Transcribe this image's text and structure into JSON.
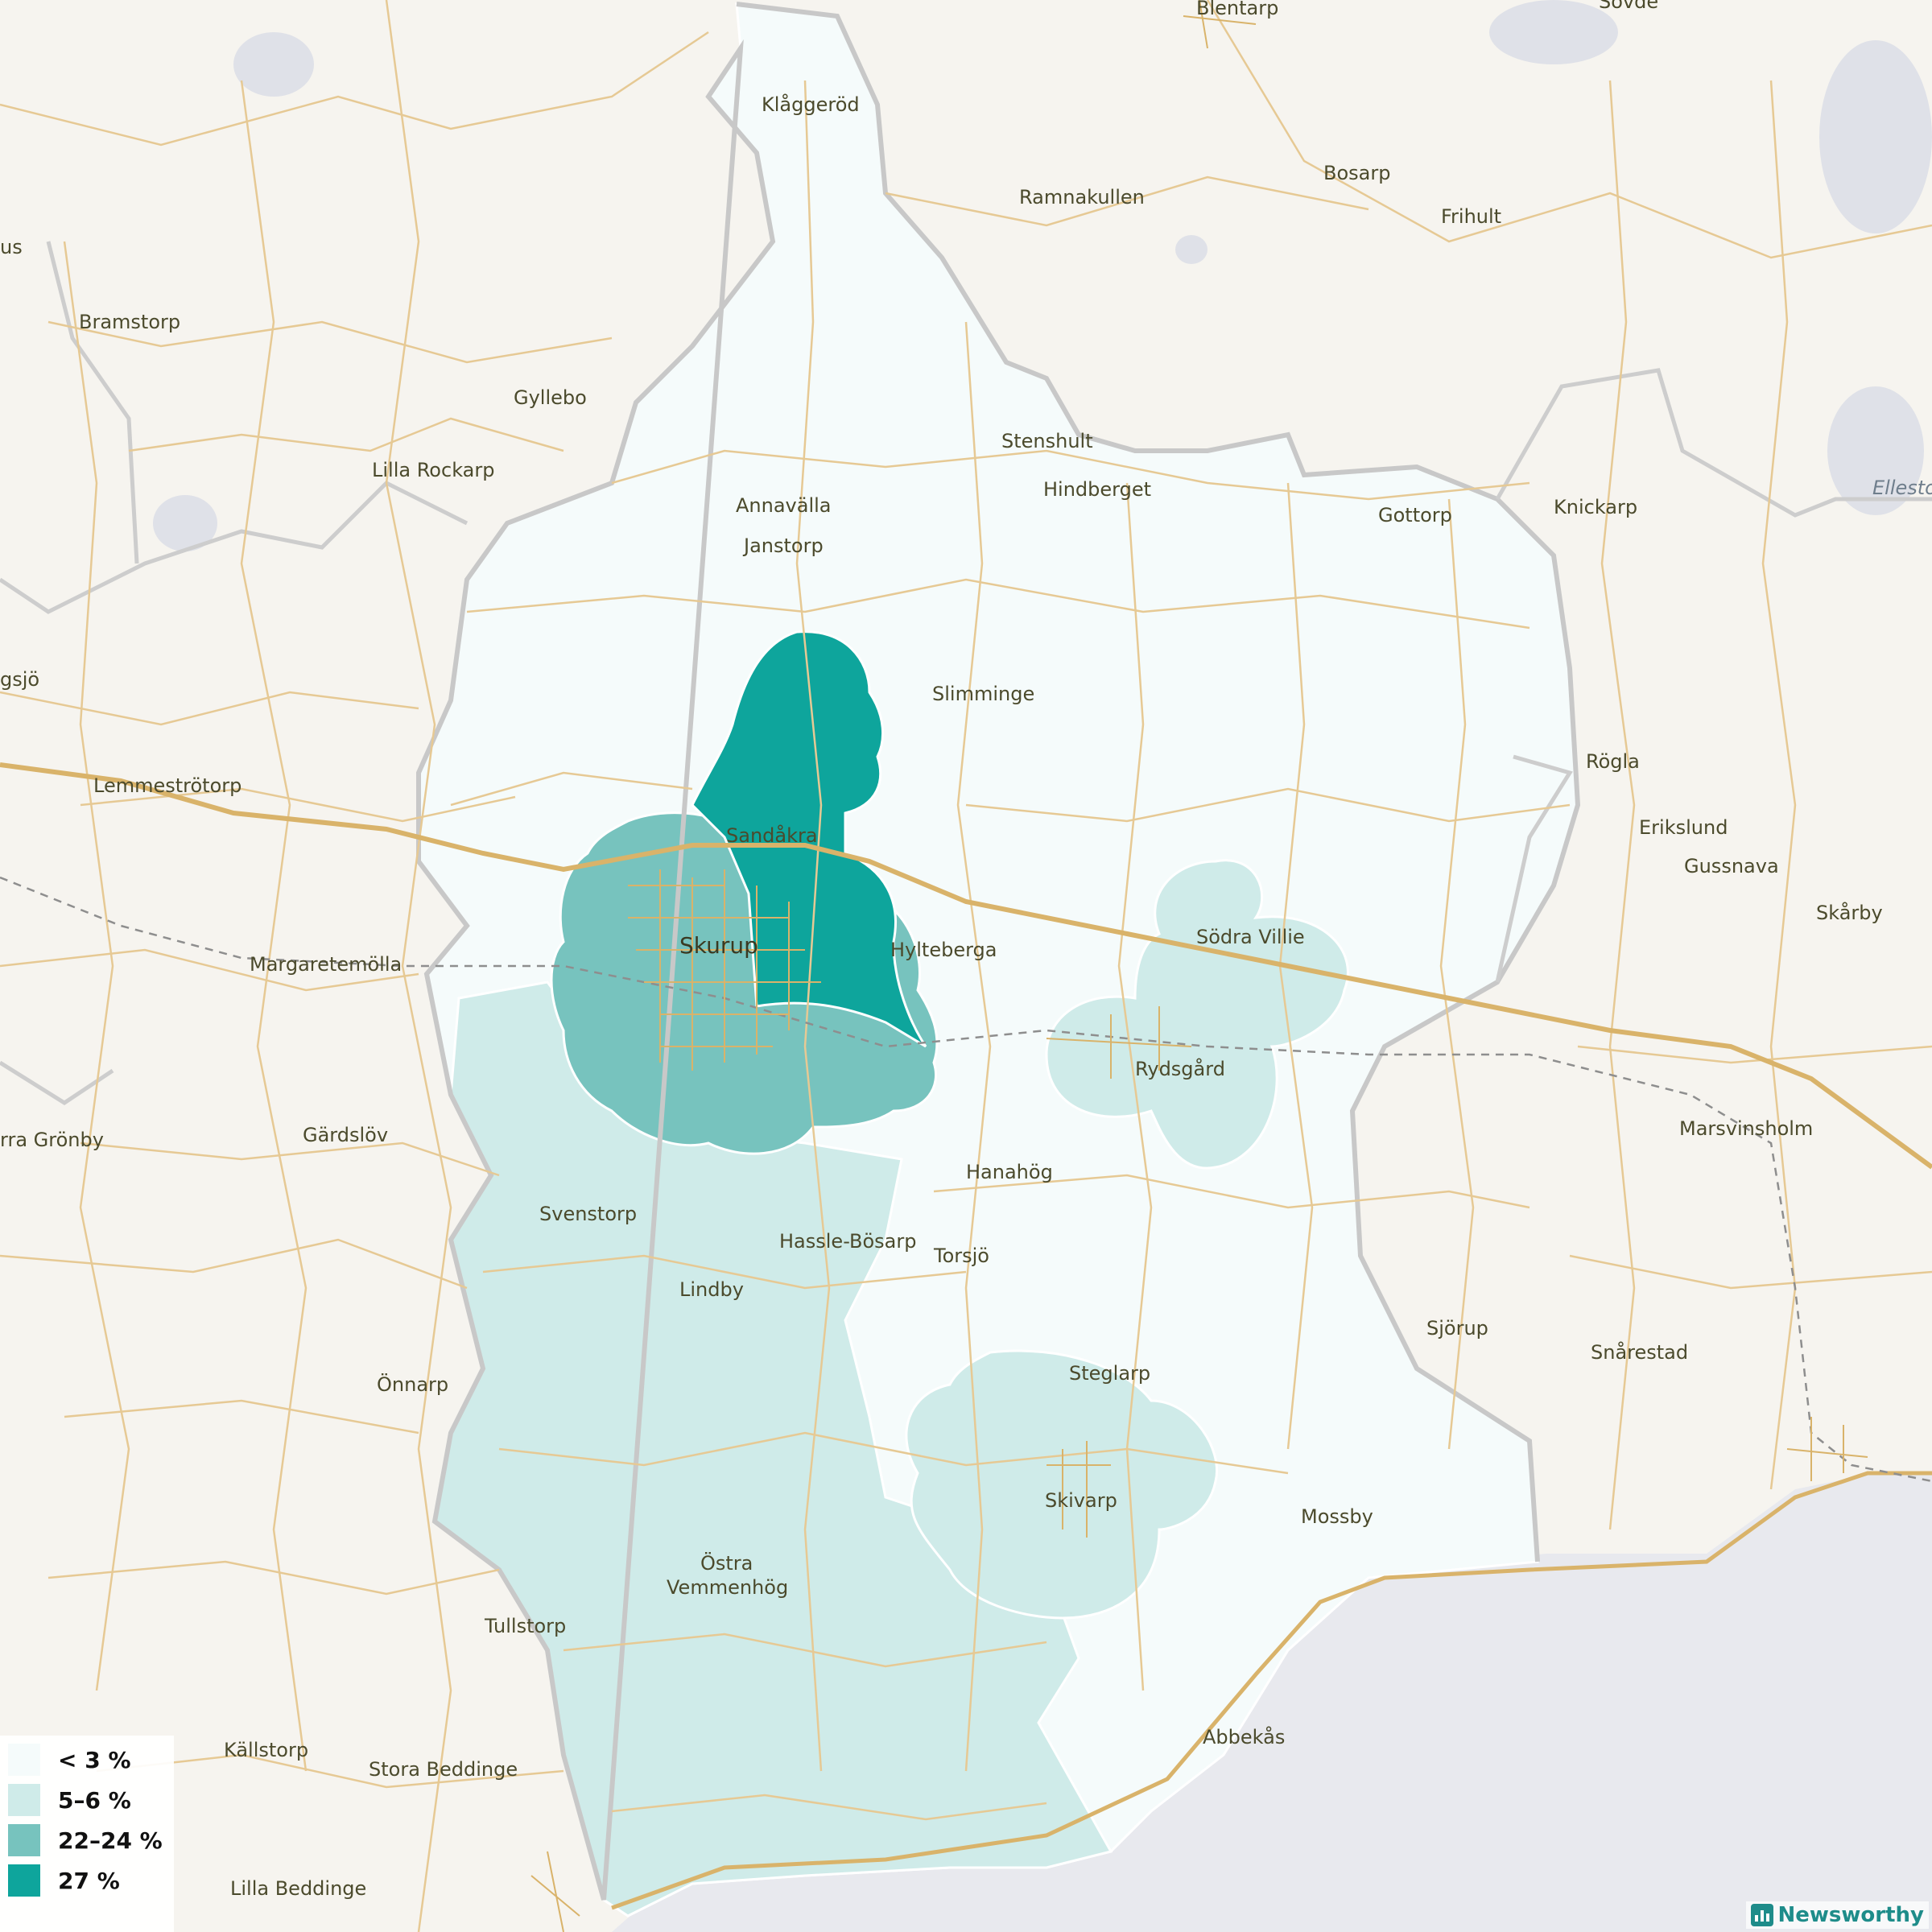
{
  "map": {
    "places": [
      {
        "name": "Blentarp"
      },
      {
        "name": "Sövde"
      },
      {
        "name": "Klåggeröd"
      },
      {
        "name": "Ramnakullen"
      },
      {
        "name": "Bosarp"
      },
      {
        "name": "Frihult"
      },
      {
        "name": "Bramstorp"
      },
      {
        "name": "Gyllebo"
      },
      {
        "name": "Lilla Rockarp"
      },
      {
        "name": "Stenshult"
      },
      {
        "name": "Hindberget"
      },
      {
        "name": "Annavälla"
      },
      {
        "name": "Janstorp"
      },
      {
        "name": "Gottorp"
      },
      {
        "name": "Knickarp"
      },
      {
        "name": "Ellesto"
      },
      {
        "name": "Slimminge"
      },
      {
        "name": "Lemmeströtorp"
      },
      {
        "name": "Rögla"
      },
      {
        "name": "Sandåkra"
      },
      {
        "name": "Erikslund"
      },
      {
        "name": "Gussnava"
      },
      {
        "name": "Skårby"
      },
      {
        "name": "Skurup"
      },
      {
        "name": "Hylteberga"
      },
      {
        "name": "Södra Villie"
      },
      {
        "name": "Margaretemölla"
      },
      {
        "name": "Rydsgård"
      },
      {
        "name": "Gärdslöv"
      },
      {
        "name": "rra Grönby"
      },
      {
        "name": "Marsvinsholm"
      },
      {
        "name": "Hanahög"
      },
      {
        "name": "Svenstorp"
      },
      {
        "name": "Hassle-Bösarp"
      },
      {
        "name": "Torsjö"
      },
      {
        "name": "Lindby"
      },
      {
        "name": "Sjörup"
      },
      {
        "name": "Snårestad"
      },
      {
        "name": "Önnarp"
      },
      {
        "name": "Steglarp"
      },
      {
        "name": "Skivarp"
      },
      {
        "name": "Mossby"
      },
      {
        "name": "Östra"
      },
      {
        "name": "Vemmenhög"
      },
      {
        "name": "Tullstorp"
      },
      {
        "name": "Abbekås"
      },
      {
        "name": "Källstorp"
      },
      {
        "name": "Stora Beddinge"
      },
      {
        "name": "Lilla Beddinge"
      },
      {
        "name": "us"
      },
      {
        "name": "gsjö"
      }
    ],
    "colors": {
      "background": "#f6f4ef",
      "sea": "#e8e9ee",
      "road": "#e6c994",
      "major_road": "#d9b36a",
      "border": "#c9c9c9",
      "class_lt3": "#f5fbfb",
      "class_5_6": "#cfebe9",
      "class_22_24": "#77c3be",
      "class_27": "#0ea59c"
    }
  },
  "legend": {
    "items": [
      {
        "label": "< 3 %",
        "color": "#f5fbfb"
      },
      {
        "label": "5–6 %",
        "color": "#cfebe9"
      },
      {
        "label": "22–24 %",
        "color": "#77c3be"
      },
      {
        "label": "27 %",
        "color": "#0ea59c"
      }
    ]
  },
  "brand": {
    "name": "Newsworthy"
  }
}
